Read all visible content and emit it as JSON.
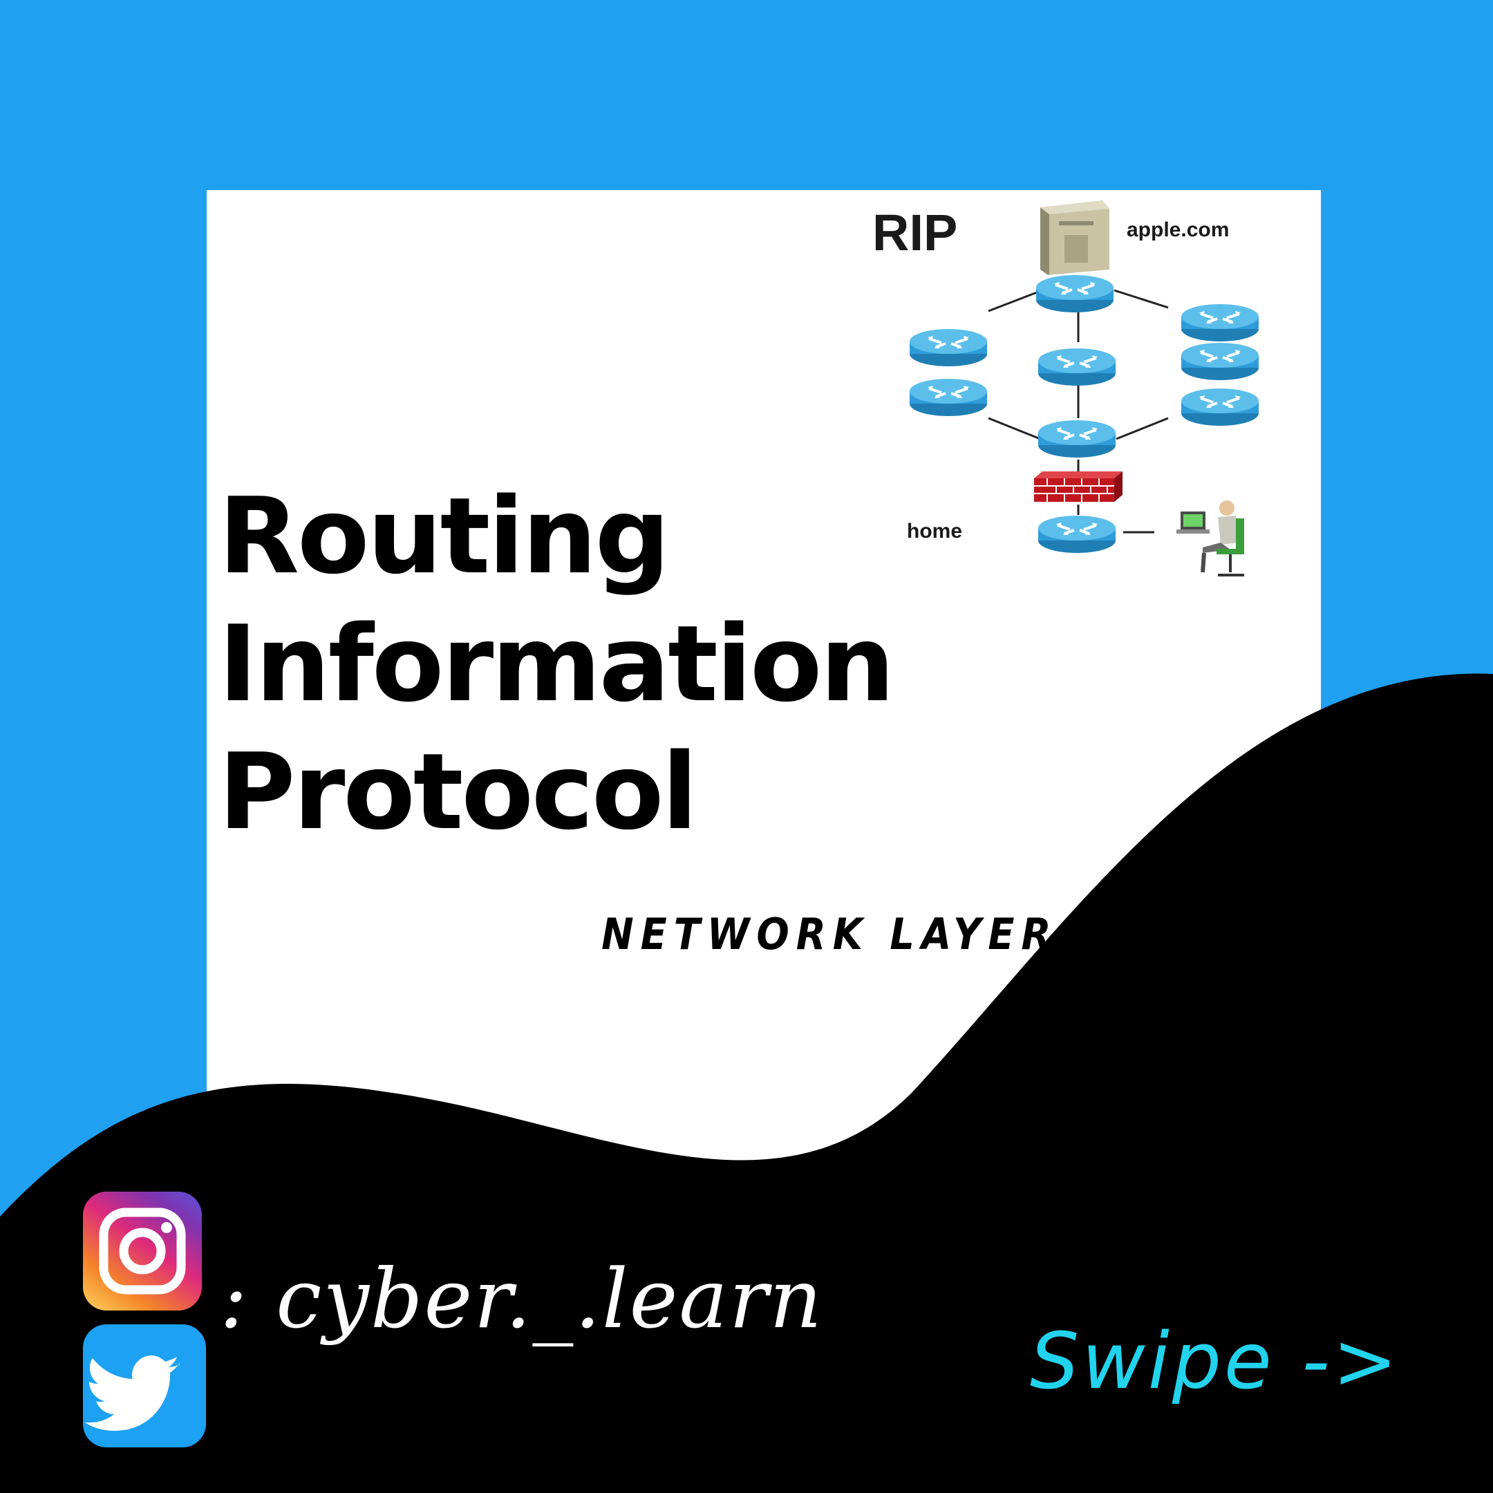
{
  "colors": {
    "background": "#1FA0F0",
    "card": "#FFFFFF",
    "wave": "#000000",
    "router": "#2E9CD8",
    "firewall": "#C0161E",
    "swipe": "#22D3EE"
  },
  "title": {
    "line1": "Routing",
    "line2": "Information",
    "line3": "Protocol"
  },
  "subtitle": "NETWORK LAYER.",
  "diagram": {
    "heading": "RIP",
    "server_label": "apple.com",
    "home_label": "home"
  },
  "social": {
    "instagram_icon": "instagram-icon",
    "twitter_icon": "twitter-icon",
    "handle": ": cyber._.learn"
  },
  "swipe": "Swipe ->"
}
